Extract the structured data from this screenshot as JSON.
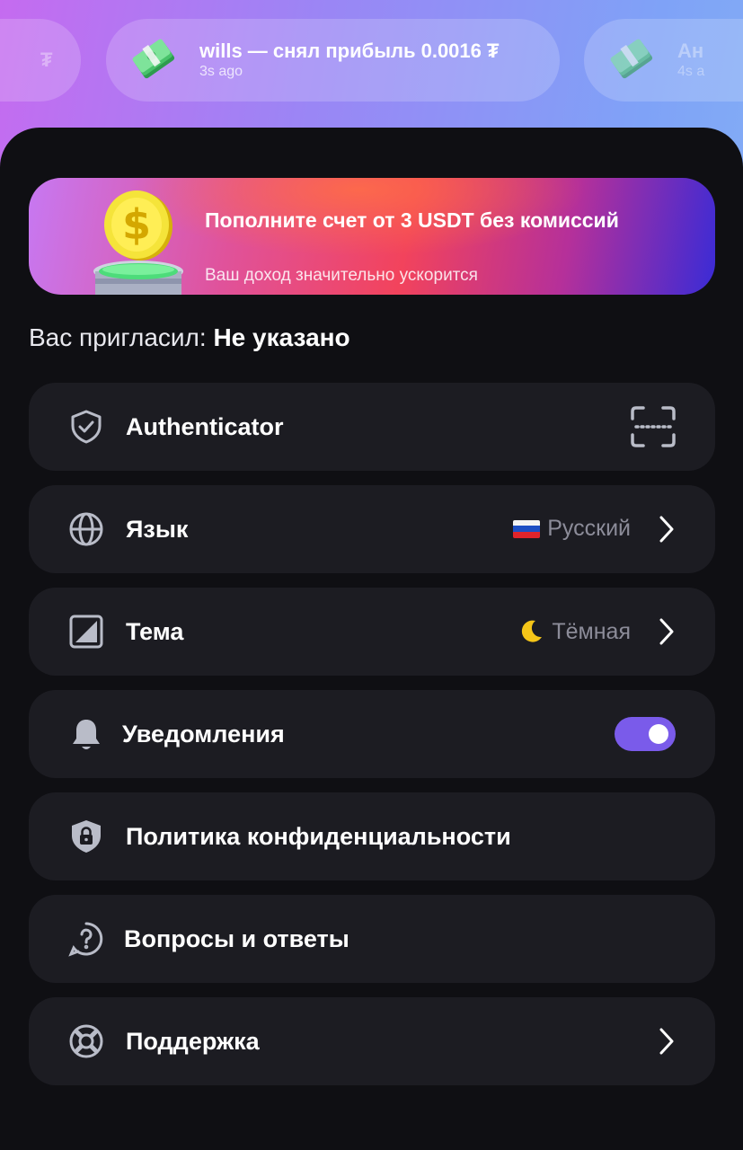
{
  "ticker": [
    {
      "main": "₮",
      "sub": ""
    },
    {
      "main": "wills — снял прибыль 0.0016 ₮",
      "sub": "3s ago"
    },
    {
      "main": "Ан",
      "sub": "4s a"
    }
  ],
  "banner": {
    "title": "Пополните счет от 3 USDT без комиссий",
    "subtitle": "Ваш доход значительно ускорится"
  },
  "invited": {
    "label": "Вас пригласил:",
    "value": "Не указано"
  },
  "settings": [
    {
      "icon": "shield-check-icon",
      "label": "Authenticator",
      "value": "",
      "control": "scan"
    },
    {
      "icon": "globe-icon",
      "label": "Язык",
      "value": "Русский",
      "control": "chevron"
    },
    {
      "icon": "theme-icon",
      "label": "Тема",
      "value": "Тёмная",
      "control": "chevron"
    },
    {
      "icon": "bell-icon",
      "label": "Уведомления",
      "value": "",
      "control": "toggle",
      "toggle_on": true
    },
    {
      "icon": "lock-shield-icon",
      "label": "Политика конфиденциальности",
      "value": "",
      "control": "none"
    },
    {
      "icon": "question-icon",
      "label": "Вопросы и ответы",
      "value": "",
      "control": "none"
    },
    {
      "icon": "lifebuoy-icon",
      "label": "Поддержка",
      "value": "",
      "control": "chevron"
    }
  ],
  "colors": {
    "sheet": "#0f0f13",
    "row": "#1c1c22",
    "toggle": "#7a5bea",
    "muted": "#8c8c99"
  }
}
